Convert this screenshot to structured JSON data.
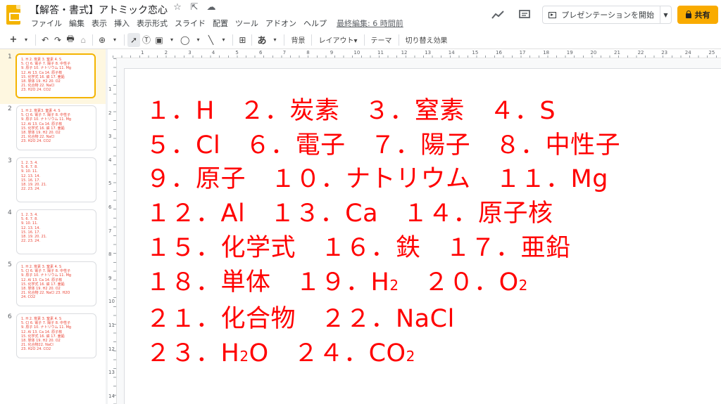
{
  "header": {
    "title": "【解答・書式】アトミック恋心",
    "title_icons": [
      "☆",
      "⇱",
      "☁"
    ],
    "menus": [
      "ファイル",
      "編集",
      "表示",
      "挿入",
      "表示形式",
      "スライド",
      "配置",
      "ツール",
      "アドオン",
      "ヘルプ"
    ],
    "last_edit": "最終編集: 6 時間前",
    "present_label": "プレゼンテーションを開始",
    "share_label": "共有"
  },
  "toolbar": {
    "new_slide": "+",
    "font_a": "あ",
    "background": "背景",
    "layout": "レイアウト▾",
    "theme": "テーマ",
    "transition": "切り替え効果"
  },
  "ruler": {
    "h": [
      "1",
      "2",
      "3",
      "4",
      "5",
      "6",
      "7",
      "8",
      "9",
      "10",
      "11",
      "12",
      "13",
      "14",
      "15",
      "16",
      "17",
      "18",
      "19",
      "20",
      "21",
      "22",
      "23",
      "24",
      "25"
    ],
    "v": [
      "1",
      "2",
      "3",
      "4",
      "5",
      "6",
      "7",
      "8",
      "9",
      "10",
      "11",
      "12",
      "13",
      "14"
    ]
  },
  "slides": [
    {
      "num": "1",
      "lines": [
        "1. H 2. 炭素 3. 窒素 4. S",
        "5. Cl 6. 電子 7. 陽子 8. 中性子",
        "9. 原子 10. ナトリウム 11. Mg",
        "12. Al 13. Ca 14. 原子核",
        "15. 化学式 16. 鉄 17. 亜鉛",
        "18. 単体 19. H2 20. O2",
        "21. 化合物 22. NaCl",
        "23. H2O 24. CO2"
      ]
    },
    {
      "num": "2",
      "lines": [
        "1. H 2. 炭素3. 窒素 4. S",
        "5. Cl 6. 電子 7. 陽子 8. 中性子",
        "9. 原子 10. ナトリウム 11. Mg",
        "12. Al 13. Ca 14. 原子核",
        "15. 化学式 16. 鉄 17. 亜鉛",
        "18. 単体 19. H2 20. O2",
        "21. 化合物 22. NaCl",
        "23. H2O 24. CO2"
      ]
    },
    {
      "num": "3",
      "lines": [
        "1. 2. 3. 4.",
        "5. 6. 7. 8.",
        "9. 10. 11.",
        "12. 13. 14.",
        "15. 16. 17.",
        "18. 19. 20. 21.",
        "22. 23. 24."
      ]
    },
    {
      "num": "4",
      "lines": [
        "1. 2. 3. 4.",
        "5. 6. 7. 8.",
        "9. 10. 11.",
        "12. 13. 14.",
        "15. 16. 17.",
        "18. 19. 20. 21.",
        "22. 23. 24."
      ]
    },
    {
      "num": "5",
      "lines": [
        "1. H 2. 炭素 3. 窒素 4. S",
        "5. Cl 6. 電子 7. 陽子 8. 中性子",
        "9. 原子 10. ナトリウム 11. Mg",
        "12. Al 13. Ca 14. 原子核",
        "15. 化学式 16. 鉄 17. 亜鉛",
        "18. 単体 19. H2 20. O2",
        "21. 化合物 22. NaCl 23. H2O",
        "24. CO2"
      ]
    },
    {
      "num": "6",
      "lines": [
        "1. H 2. 炭素 3. 窒素 4. S",
        "5. Cl 6. 電子 7. 陽子 8. 中性子",
        "9. 原子 10. ナトリウム 11. Mg",
        "12. Al 13. Ca 14. 原子核",
        "15. 化学式 16. 鉄 17. 亜鉛",
        "18. 単体 19. H2 20. O2",
        "21. 化合物22. NaCl",
        "23. H2O 24. CO2"
      ]
    }
  ],
  "main_slide": {
    "lines": [
      [
        {
          "t": "１．H　２．炭素　３．窒素　４．S"
        }
      ],
      [
        {
          "t": "５．Cl　６．電子　７．陽子　８．中性子"
        }
      ],
      [
        {
          "t": "９．原子　１０．ナトリウム　１１．Mg"
        }
      ],
      [
        {
          "t": "１２．Al　１３．Ca　１４．原子核"
        }
      ],
      [
        {
          "t": "１５．化学式　１６．鉄　１７．亜鉛"
        }
      ],
      [
        {
          "t": "１８．単体　１９．H"
        },
        {
          "t": "2",
          "sub": true
        },
        {
          "t": "　２０．O"
        },
        {
          "t": "2",
          "sub": true
        }
      ],
      [
        {
          "t": "２１．化合物　２２．NaCl"
        }
      ],
      [
        {
          "t": "２３．H"
        },
        {
          "t": "2",
          "sub": true
        },
        {
          "t": "O　２４．CO"
        },
        {
          "t": "2",
          "sub": true
        }
      ]
    ],
    "color": "#ff0000"
  },
  "colors": {
    "accent": "#f4b400",
    "share": "#f9ab00",
    "answer": "#ff0000"
  }
}
